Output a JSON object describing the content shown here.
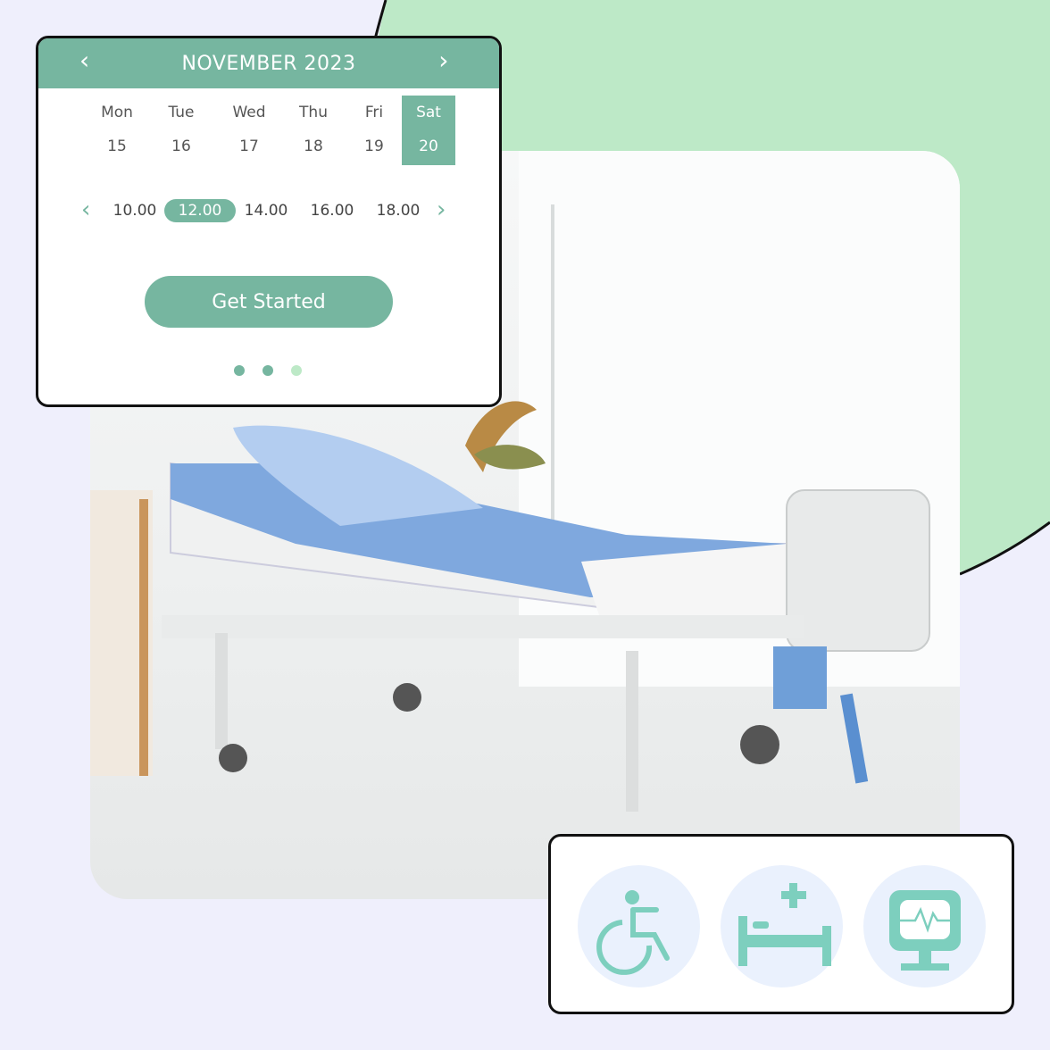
{
  "colors": {
    "accent": "#76b6a0",
    "blob": "#bde9c7",
    "background": "#efeffc",
    "icon": "#7dcfbe",
    "icon_bg": "#eaf1fd"
  },
  "calendar": {
    "title": "NOVEMBER 2023",
    "prev_icon": "chevron-left-icon",
    "next_icon": "chevron-right-icon",
    "days": [
      {
        "weekday": "Mon",
        "date": "15",
        "selected": false
      },
      {
        "weekday": "Tue",
        "date": "16",
        "selected": false
      },
      {
        "weekday": "Wed",
        "date": "17",
        "selected": false
      },
      {
        "weekday": "Thu",
        "date": "18",
        "selected": false
      },
      {
        "weekday": "Fri",
        "date": "19",
        "selected": false
      },
      {
        "weekday": "Sat",
        "date": "20",
        "selected": true
      }
    ],
    "times": [
      {
        "label": "10.00",
        "selected": false
      },
      {
        "label": "12.00",
        "selected": true
      },
      {
        "label": "14.00",
        "selected": false
      },
      {
        "label": "16.00",
        "selected": false
      },
      {
        "label": "18.00",
        "selected": false
      }
    ],
    "button_label": "Get Started",
    "pagination": {
      "pages": 3,
      "current": 3
    }
  },
  "features": {
    "icons": [
      "wheelchair-icon",
      "hospital-bed-icon",
      "heart-monitor-icon"
    ]
  },
  "photo": {
    "subject": "hospital-bed-photo"
  }
}
